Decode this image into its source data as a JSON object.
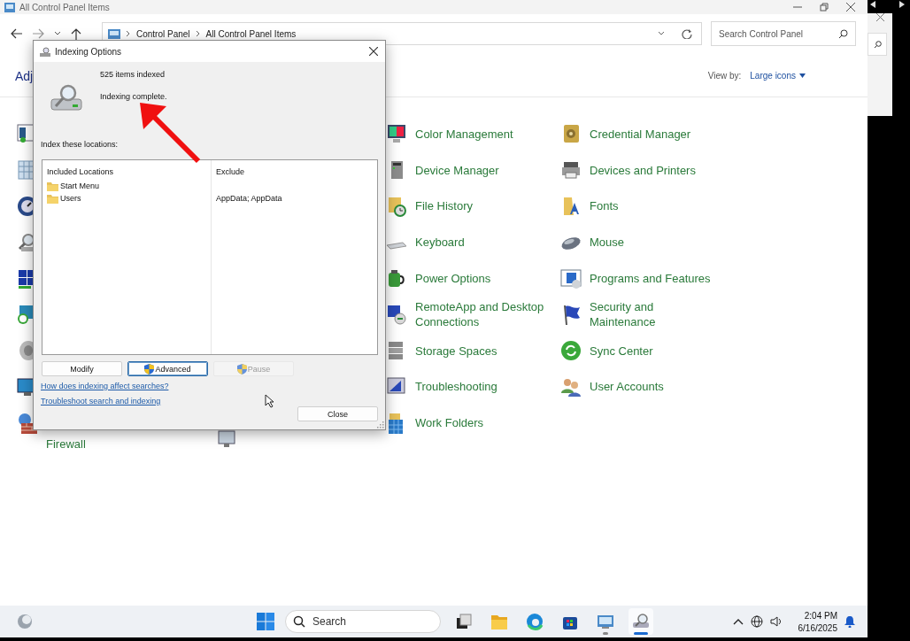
{
  "window": {
    "title": "All Control Panel Items"
  },
  "address_bar": {
    "path": [
      "Control Panel",
      "All Control Panel Items"
    ]
  },
  "search": {
    "placeholder": "Search Control Panel"
  },
  "content": {
    "heading": "Adj",
    "view_by_label": "View by:",
    "view_by_value": "Large icons",
    "left_label": "Firewall",
    "items": [
      {
        "label": "Color Management"
      },
      {
        "label": "Credential Manager"
      },
      {
        "label": "Device Manager"
      },
      {
        "label": "Devices and Printers"
      },
      {
        "label": "File History"
      },
      {
        "label": "Fonts"
      },
      {
        "label": "Keyboard"
      },
      {
        "label": "Mouse"
      },
      {
        "label": "Power Options"
      },
      {
        "label": "Programs and Features"
      },
      {
        "label": "RemoteApp and Desktop Connections"
      },
      {
        "label": "Security and Maintenance"
      },
      {
        "label": "Storage Spaces"
      },
      {
        "label": "Sync Center"
      },
      {
        "label": "Troubleshooting"
      },
      {
        "label": "User Accounts"
      },
      {
        "label": "Work Folders"
      }
    ]
  },
  "dialog": {
    "title": "Indexing Options",
    "count": "525 items indexed",
    "status": "Indexing complete.",
    "locations_label": "Index these locations:",
    "columns": [
      "Included Locations",
      "Exclude"
    ],
    "rows": [
      {
        "location": "Start Menu"
      },
      {
        "location": "Users",
        "exclude": "AppData; AppData"
      }
    ],
    "buttons": [
      {
        "label": "Modify",
        "kind": "plain",
        "focused": false,
        "disabled": false
      },
      {
        "label": "Advanced",
        "kind": "shield",
        "focused": true,
        "disabled": false
      },
      {
        "label": "Pause",
        "kind": "shield",
        "focused": false,
        "disabled": true
      }
    ],
    "links": [
      "How does indexing affect searches?",
      "Troubleshoot search and indexing"
    ],
    "close_button": "Close"
  },
  "taskbar": {
    "search_placeholder": "Search",
    "apps": [
      {
        "running": false,
        "selected": false
      },
      {
        "running": false,
        "selected": false
      },
      {
        "running": false,
        "selected": false
      },
      {
        "running": false,
        "selected": false
      },
      {
        "running": true,
        "selected": false
      },
      {
        "running": true,
        "selected": true
      }
    ],
    "time": "2:04 PM",
    "date": "6/16/2025"
  }
}
